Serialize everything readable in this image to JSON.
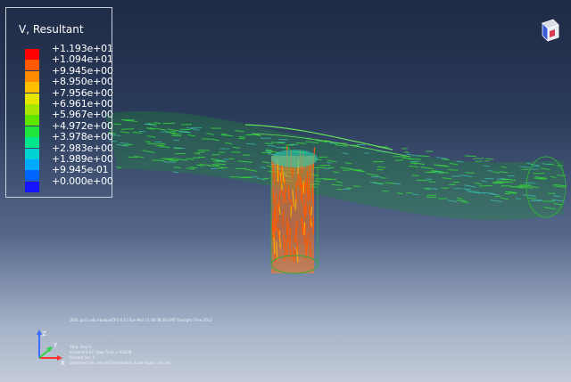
{
  "legend": {
    "title": "V, Resultant",
    "values": [
      "+1.193e+01",
      "+1.094e+01",
      "+9.945e+00",
      "+8.950e+00",
      "+7.956e+00",
      "+6.961e+00",
      "+5.967e+00",
      "+4.972e+00",
      "+3.978e+00",
      "+2.983e+00",
      "+1.989e+00",
      "+9.945e-01",
      "+0.000e+00"
    ],
    "colors": [
      "#ff0000",
      "#ff5a00",
      "#ff8c00",
      "#ffbe00",
      "#e6e600",
      "#a6e600",
      "#5ee600",
      "#1ee63c",
      "#00e68c",
      "#00d2d2",
      "#00aaff",
      "#0064ff",
      "#1414ff"
    ]
  },
  "colors": {
    "background_top": "#1f2b45",
    "background_bottom": "#c4cbd8",
    "vectors_pipe": "#36d23c",
    "vectors_jet": "#ff6a10"
  },
  "status": {
    "line1": "ODB: pcs1.odb    Abaqus/CFD 6.13    Sun Mar 11 08:38:38 GMT Daylight Time 2013",
    "line2": "Step: Step-1",
    "line3": "Increment     67: Step Time =     0.6038",
    "line4": "Primary Var: V",
    "line5": "Deformed Var: not set   Deformation Scale Factor: not set"
  },
  "triad": {
    "x_label": "X",
    "y_label": "Y",
    "z_label": "Z"
  },
  "icons": {
    "triad": "xyz-triad-icon",
    "view_cube": "view-cube-icon"
  }
}
